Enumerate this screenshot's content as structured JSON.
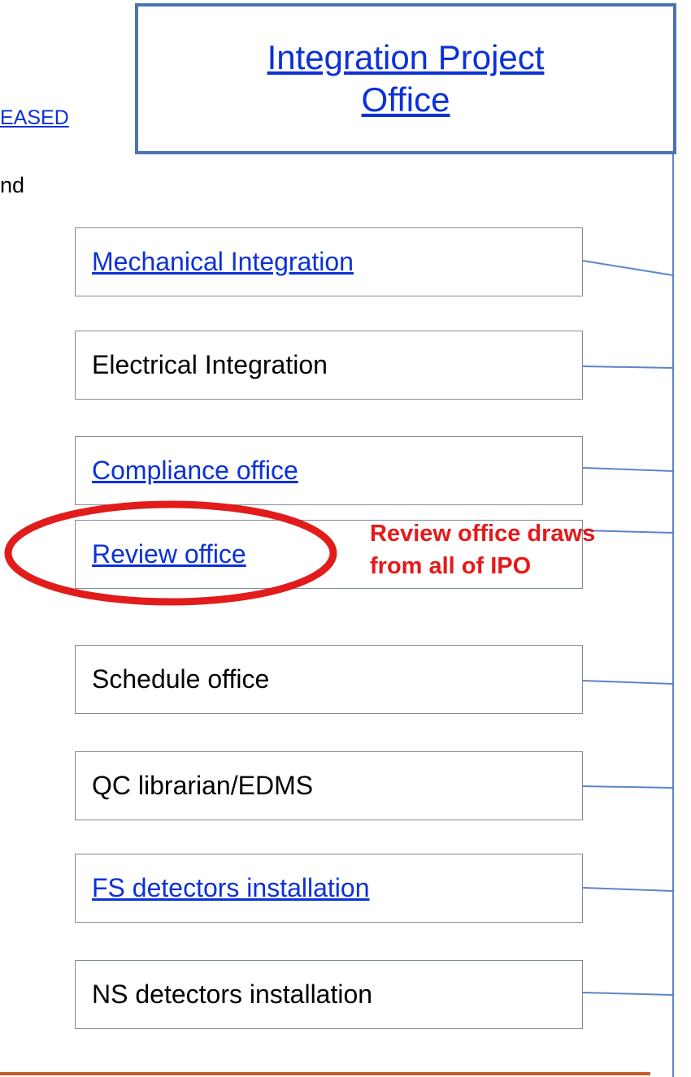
{
  "fragments": {
    "left_link_text": "EASED",
    "left_text": "nd"
  },
  "ipo": {
    "title": "Integration Project Office"
  },
  "units": [
    {
      "label": "Mechanical Integration",
      "link": true
    },
    {
      "label": "Electrical Integration",
      "link": false
    },
    {
      "label": "Compliance office",
      "link": true
    },
    {
      "label": "Review office",
      "link": true
    },
    {
      "label": "Schedule office",
      "link": false
    },
    {
      "label": "QC librarian/EDMS",
      "link": false
    },
    {
      "label": "FS detectors installation",
      "link": true
    },
    {
      "label": "NS detectors installation",
      "link": false
    }
  ],
  "annotation": {
    "text": "Review office draws\nfrom all of IPO"
  },
  "colors": {
    "link": "#0b31d9",
    "ipo_border": "#4a74b1",
    "connector": "#5b85c4",
    "highlight": "#e21b1b",
    "footer_rule": "#c55a28"
  }
}
